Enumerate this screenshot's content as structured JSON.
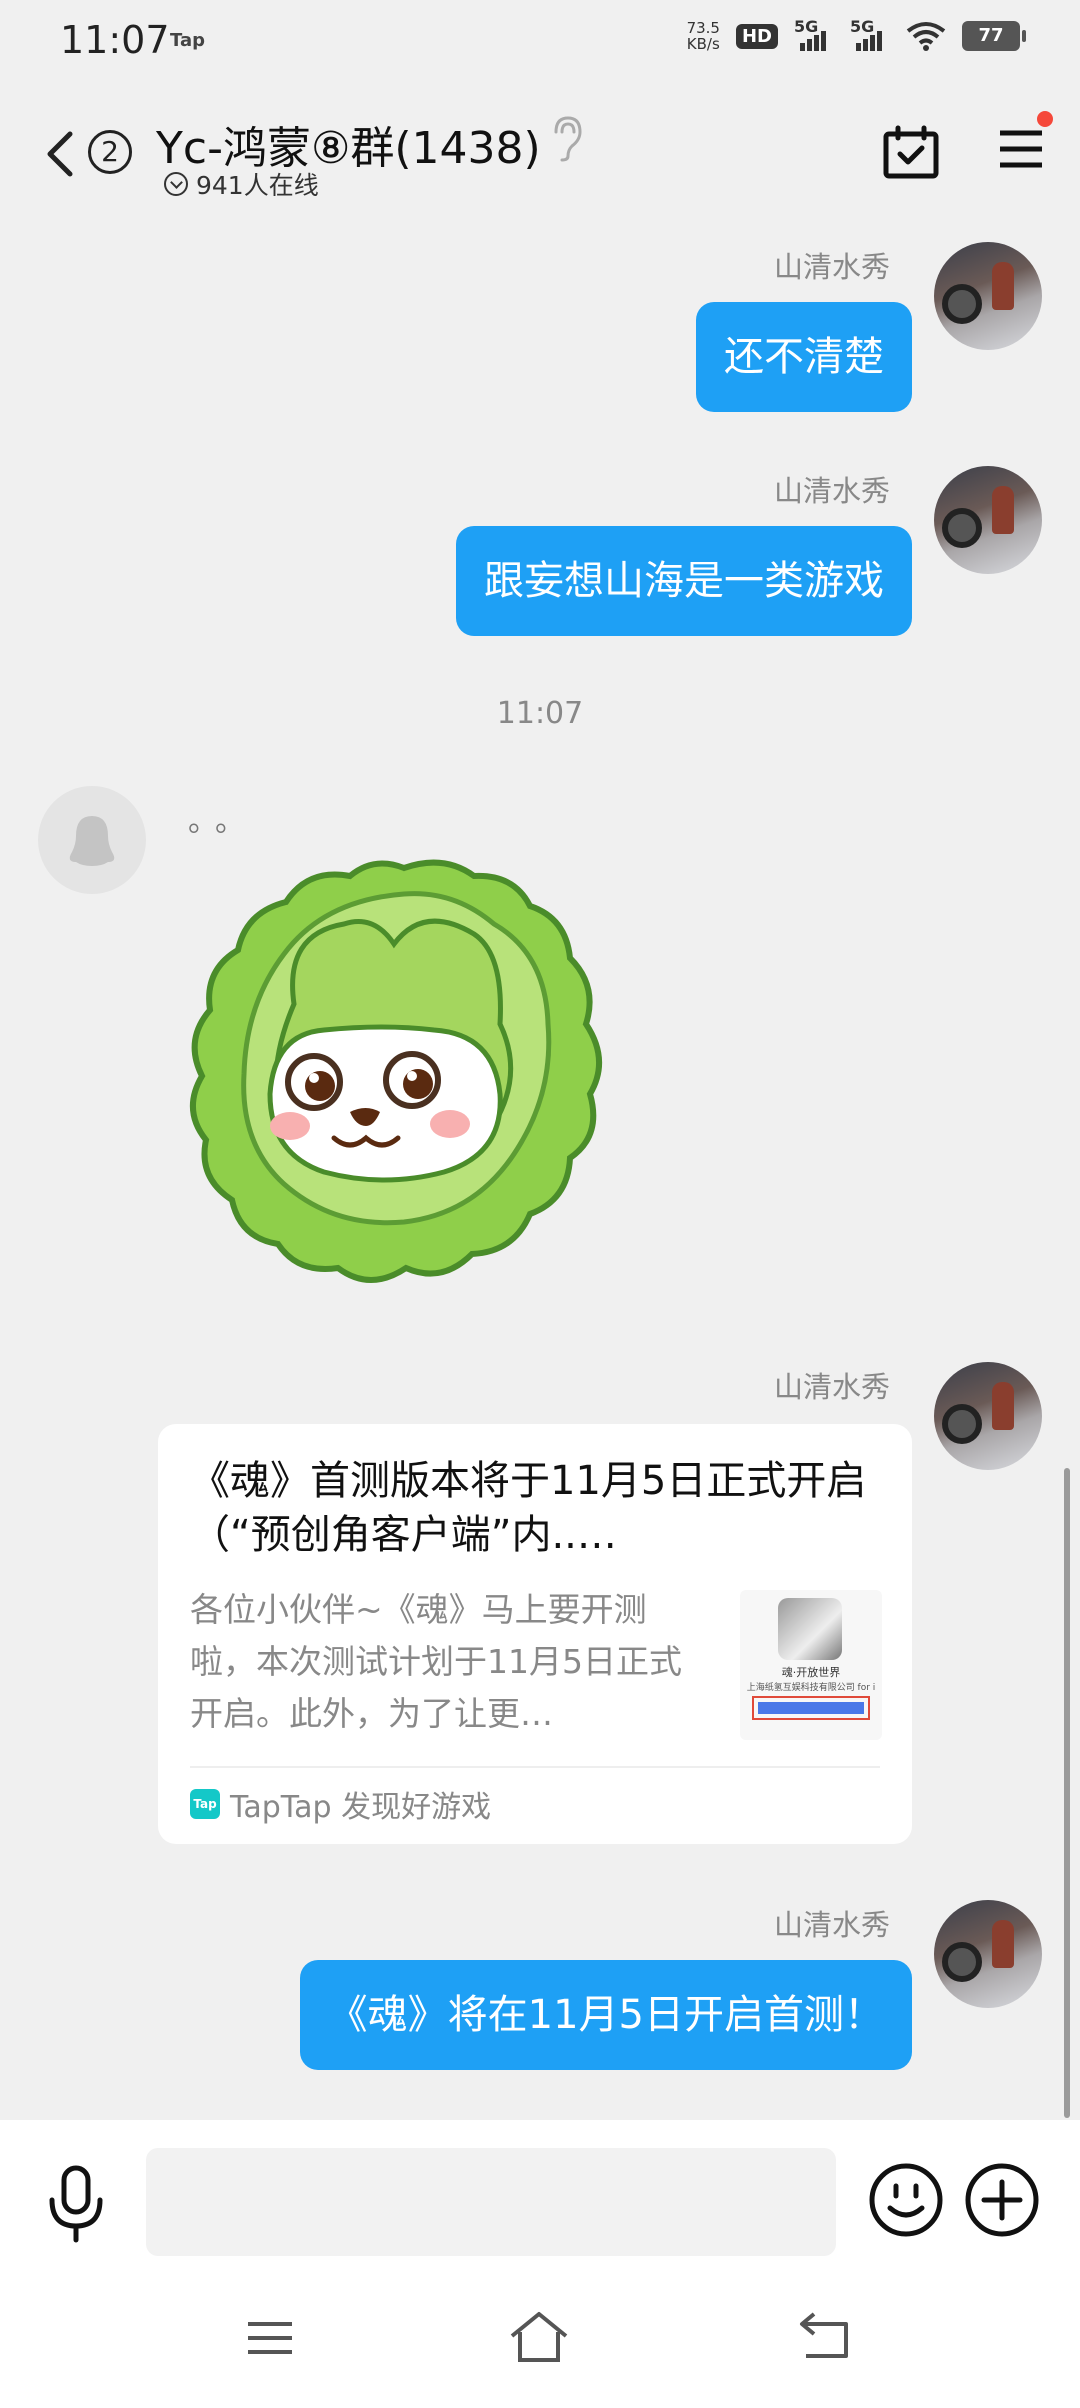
{
  "status_bar": {
    "time": "11:07",
    "app_label": "Tap",
    "net_speed_value": "73.5",
    "net_speed_unit": "KB/s",
    "hd_badge": "HD",
    "signal1": "5G",
    "signal2": "5G",
    "battery": "77"
  },
  "header": {
    "unread_count": "2",
    "group_title": "Yc-鸿蒙⑧群(1438)",
    "online_text": "941人在线"
  },
  "messages": [
    {
      "sender": "山清水秀",
      "text": "还不清楚"
    },
    {
      "sender": "山清水秀",
      "text": "跟妄想山海是一类游戏"
    }
  ],
  "time_divider": "11:07",
  "other_message": {
    "text": "。。"
  },
  "link_card": {
    "sender": "山清水秀",
    "title": "《魂》首测版本将于11月5日正式开启（“预创角客户端”内..…",
    "description": "各位小伙伴~《魂》马上要开测啦，本次测试计划于11月5日正式开启。此外，为了让更…",
    "thumb_title": "魂·开放世界",
    "thumb_sub": "上海纸氢互娱科技有限公司 for i",
    "source_icon": "Tap",
    "source_text": "TapTap 发现好游戏"
  },
  "last_message": {
    "sender": "山清水秀",
    "text": "《魂》将在11月5日开启首测！"
  },
  "input": {
    "placeholder": ""
  },
  "colors": {
    "bubble_blue": "#1ea0f5",
    "background": "#f0f0f0",
    "notification_dot": "#f5483a",
    "taptap_teal": "#14c8c8"
  },
  "icons": [
    "back-icon",
    "ear-icon",
    "calendar-check-icon",
    "menu-icon",
    "mic-icon",
    "emoji-icon",
    "plus-icon",
    "nav-menu-icon",
    "nav-home-icon",
    "nav-back-icon"
  ]
}
